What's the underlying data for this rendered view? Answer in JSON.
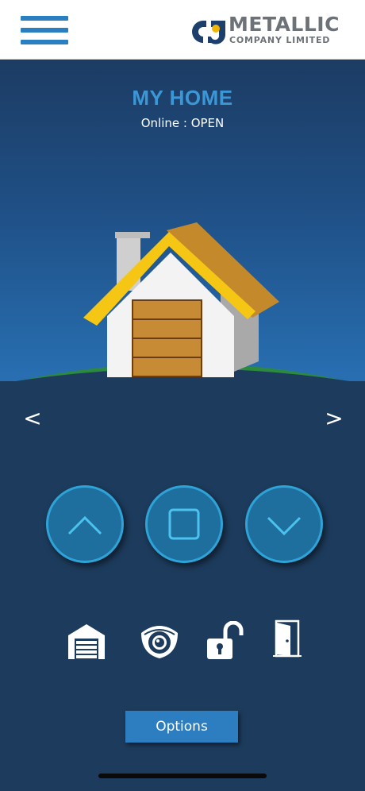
{
  "header": {
    "menu_icon": "hamburger-menu-icon",
    "logo": {
      "line1": "METALLIC",
      "line2": "COMPANY LIMITED"
    }
  },
  "home": {
    "title": "MY HOME",
    "status": "Online : OPEN"
  },
  "navigation": {
    "prev": "<",
    "next": ">"
  },
  "controls": [
    {
      "name": "open-button",
      "icon": "chevron-up-icon"
    },
    {
      "name": "stop-button",
      "icon": "square-stop-icon"
    },
    {
      "name": "close-button",
      "icon": "chevron-down-icon"
    }
  ],
  "devices": [
    {
      "name": "garage-device-button",
      "icon": "garage-icon"
    },
    {
      "name": "camera-device-button",
      "icon": "camera-icon"
    },
    {
      "name": "lock-device-button",
      "icon": "unlock-icon"
    },
    {
      "name": "door-device-button",
      "icon": "door-icon"
    }
  ],
  "options_label": "Options",
  "colors": {
    "accent": "#2d7ec1",
    "title": "#3b97d6",
    "background": "#1d3b5c",
    "button_ring": "#2ea3d8",
    "roof": "#c4892a",
    "grass": "#2b8a3e"
  }
}
